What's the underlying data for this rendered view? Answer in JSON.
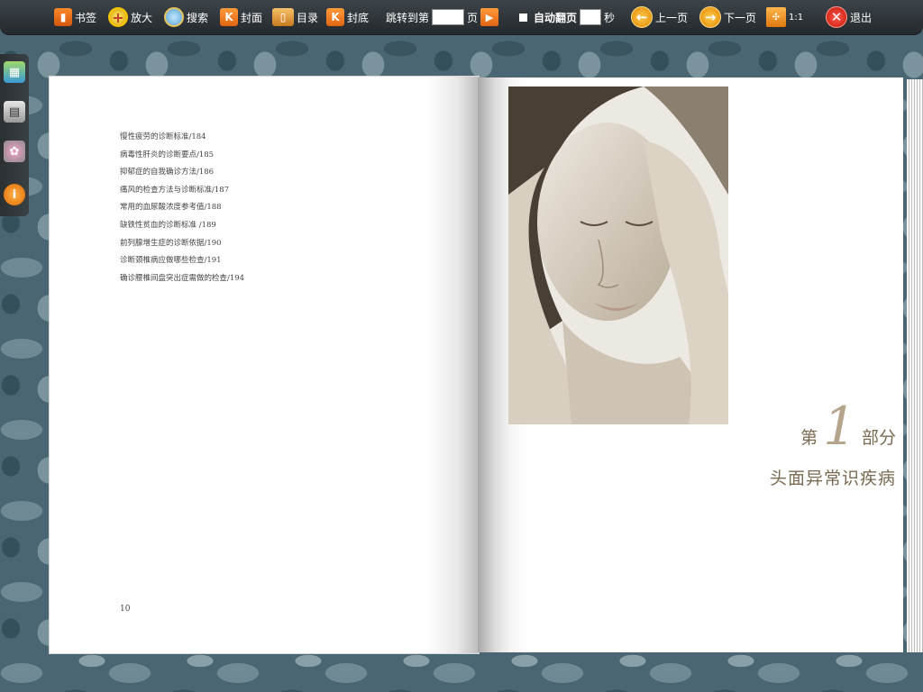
{
  "toolbar": {
    "bookmark": "书签",
    "zoom_in": "放大",
    "search": "搜索",
    "cover": "封面",
    "toc": "目录",
    "back_cover": "封底",
    "jump_to": "跳转到第",
    "page_unit": "页",
    "auto_flip": "自动翻页",
    "seconds": "秒",
    "prev_page": "上一页",
    "next_page": "下一页",
    "zoom_ratio": "1:1",
    "exit": "退出"
  },
  "left_page": {
    "toc_items": [
      "慢性疲劳的诊断标准/184",
      "病毒性肝炎的诊断要点/185",
      "抑郁症的自我确诊方法/186",
      "痛风的检查方法与诊断标准/187",
      "常用的血尿酸浓度参考值/188",
      "缺铁性贫血的诊断标准 /189",
      "前列腺增生症的诊断依据/190",
      "诊断颈椎病应做哪些检查/191",
      "确诊腰椎间盘突出症需做的检查/194"
    ],
    "page_number": "10"
  },
  "right_page": {
    "part_prefix": "第",
    "part_number": "1",
    "part_suffix": "部分",
    "part_title": "头面异常识疾病"
  },
  "colors": {
    "toolbar": "#2c3236",
    "accent_orange": "#e8701a",
    "section_text": "#7a6a52"
  }
}
